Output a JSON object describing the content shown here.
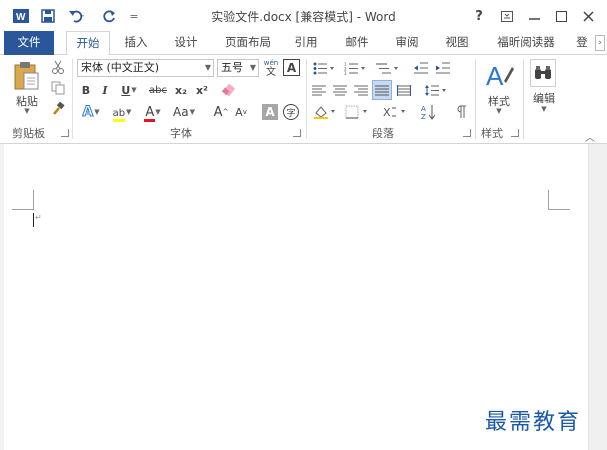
{
  "title": "实验文件.docx [兼容模式] - Word",
  "window_buttons": {
    "help": "?",
    "restore_ribbon": "▣",
    "minimize": "—",
    "maximize": "☐",
    "close": "✕"
  },
  "quick_access": {
    "app_icon": "W",
    "save_icon": "save-icon",
    "undo_icon": "undo-icon",
    "redo_icon": "redo-icon",
    "customize": "="
  },
  "tabs": [
    "文件",
    "开始",
    "插入",
    "设计",
    "页面布局",
    "引用",
    "邮件",
    "审阅",
    "视图",
    "福昕阅读器",
    "登"
  ],
  "ribbon": {
    "clipboard": {
      "paste_label": "粘贴",
      "group_label": "剪贴板"
    },
    "font": {
      "font_name": "宋体 (中文正文)",
      "font_size": "五号",
      "phonetic_top": "wén",
      "phonetic_bottom": "文",
      "border_char": "A",
      "bold": "B",
      "italic": "I",
      "underline": "U",
      "strike": "abc",
      "subscript": "x₂",
      "superscript": "x²",
      "text_effect": "A",
      "highlight": "ab",
      "font_color": "A",
      "change_case": "Aa",
      "grow": "A",
      "shrink": "A",
      "shading_char": "A",
      "enclose_char": "字",
      "group_label": "字体"
    },
    "paragraph": {
      "group_label": "段落"
    },
    "styles": {
      "styles_label": "样式",
      "group_label": "样式"
    },
    "editing": {
      "editing_label": "编辑"
    }
  },
  "watermark": "最需教育",
  "colors": {
    "accent": "#2b579a",
    "highlight": "#ffff00",
    "font_red": "#e81123"
  }
}
